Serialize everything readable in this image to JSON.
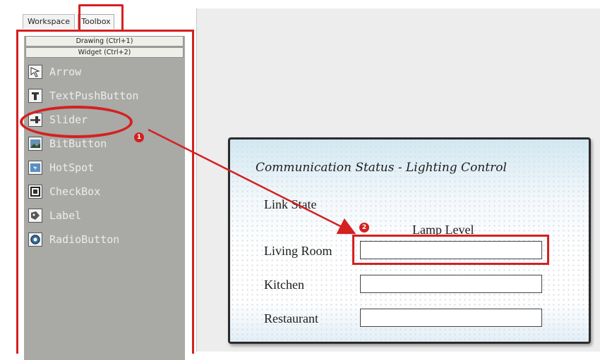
{
  "tabs": {
    "workspace": "Workspace",
    "toolbox": "Toolbox"
  },
  "toolbox": {
    "sections": [
      "Drawing (Ctrl+1)",
      "Widget (Ctrl+2)"
    ],
    "items": [
      {
        "label": "Arrow",
        "icon": "arrow-icon"
      },
      {
        "label": "TextPushButton",
        "icon": "text-button-icon"
      },
      {
        "label": "Slider",
        "icon": "slider-icon"
      },
      {
        "label": "BitButton",
        "icon": "bitmap-button-icon"
      },
      {
        "label": "HotSpot",
        "icon": "hotspot-icon"
      },
      {
        "label": "CheckBox",
        "icon": "checkbox-icon"
      },
      {
        "label": "Label",
        "icon": "label-icon"
      },
      {
        "label": "RadioButton",
        "icon": "radio-button-icon"
      }
    ]
  },
  "callouts": {
    "step1": "1",
    "step2": "2"
  },
  "widget": {
    "title": "Communication Status - Lighting Control",
    "link_state": "Link State",
    "lamp_level": "Lamp Level",
    "rows": [
      "Living Room",
      "Kitchen",
      "Restaurant"
    ]
  },
  "colors": {
    "highlight": "#d42020",
    "toolbox_bg": "#a9a9a6",
    "canvas_bg": "#ededed"
  }
}
